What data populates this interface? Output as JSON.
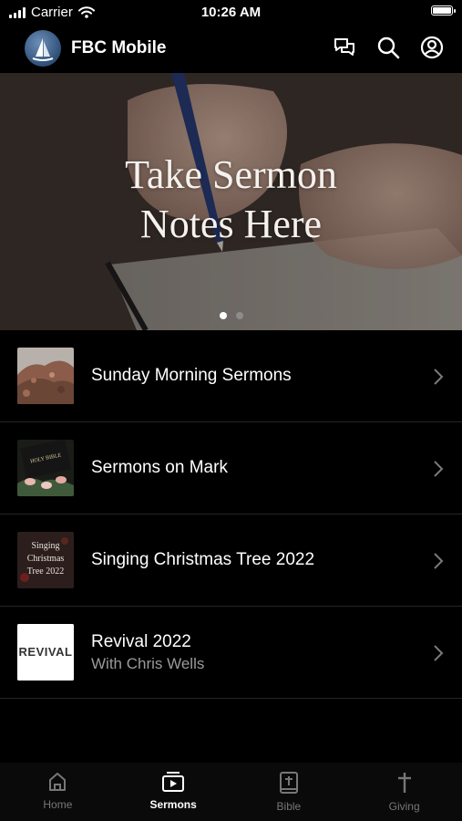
{
  "status_bar": {
    "carrier": "Carrier",
    "time": "10:26 AM"
  },
  "header": {
    "title": "FBC Mobile",
    "icons": [
      "chat-icon",
      "search-icon",
      "account-icon"
    ]
  },
  "hero": {
    "line1": "Take Sermon",
    "line2": "Notes Here",
    "dots_total": 2,
    "active_dot": 1
  },
  "series": [
    {
      "title": "Sunday Morning Sermons",
      "subtitle": ""
    },
    {
      "title": "Sermons on Mark",
      "subtitle": "",
      "thumb_text": "HOLY BIBLE"
    },
    {
      "title": "Singing Christmas Tree 2022",
      "subtitle": "",
      "thumb_lines": [
        "Singing",
        "Christmas",
        "Tree 2022"
      ]
    },
    {
      "title": "Revival 2022",
      "subtitle": "With Chris Wells",
      "thumb_text": "REVIVAL"
    }
  ],
  "tabs": [
    {
      "label": "Home",
      "icon": "home-icon",
      "active": false
    },
    {
      "label": "Sermons",
      "icon": "video-icon",
      "active": true
    },
    {
      "label": "Bible",
      "icon": "bible-icon",
      "active": false
    },
    {
      "label": "Giving",
      "icon": "cross-icon",
      "active": false
    }
  ],
  "colors": {
    "background": "#000000",
    "active_tab": "#ffffff",
    "inactive_tab": "#777777",
    "subtitle": "#9a9a9a"
  }
}
